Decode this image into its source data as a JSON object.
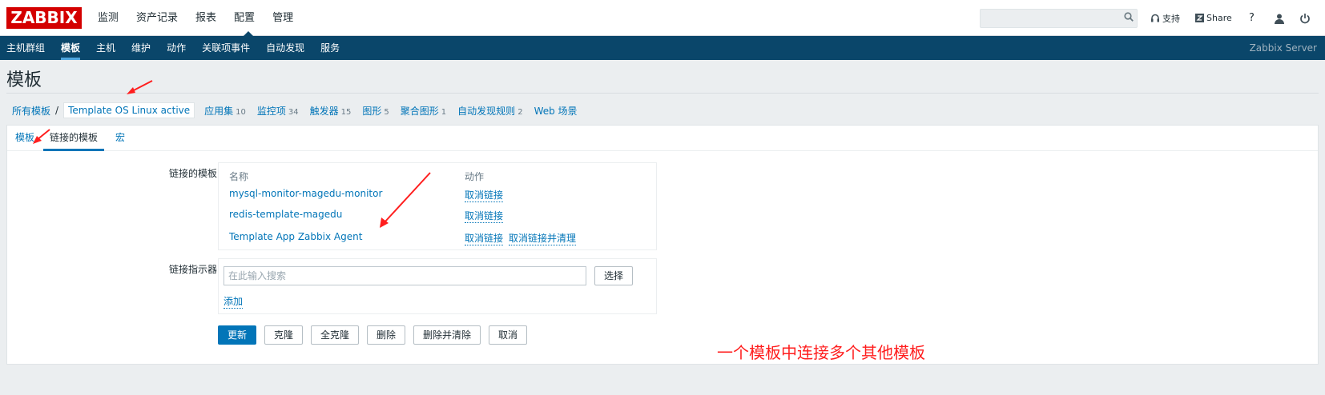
{
  "app": {
    "logo": "ZABBIX",
    "main_nav": [
      "监测",
      "资产记录",
      "报表",
      "配置",
      "管理"
    ],
    "main_nav_active": "配置",
    "search": {
      "placeholder": "",
      "value": ""
    },
    "top_right": {
      "support": "支持",
      "share": "Share",
      "help": "?"
    },
    "sub_nav": [
      "主机群组",
      "模板",
      "主机",
      "维护",
      "动作",
      "关联项事件",
      "自动发现",
      "服务"
    ],
    "sub_nav_active": "模板",
    "server_name": "Zabbix Server"
  },
  "page": {
    "title": "模板",
    "breadcrumb": {
      "all": "所有模板",
      "sep": "/",
      "current": "Template OS Linux active",
      "sections": [
        {
          "label": "应用集",
          "count": "10"
        },
        {
          "label": "监控项",
          "count": "34"
        },
        {
          "label": "触发器",
          "count": "15"
        },
        {
          "label": "图形",
          "count": "5"
        },
        {
          "label": "聚合图形",
          "count": "1"
        },
        {
          "label": "自动发现规则",
          "count": "2"
        },
        {
          "label": "Web 场景",
          "count": ""
        }
      ]
    },
    "tabs": [
      "模板",
      "链接的模板",
      "宏"
    ],
    "active_tab": "链接的模板"
  },
  "form": {
    "linked_label": "链接的模板",
    "linked_table": {
      "col_name": "名称",
      "col_action": "动作",
      "rows": [
        {
          "name": "mysql-monitor-magedu-monitor",
          "unlink": "取消链接",
          "unlink_clear": ""
        },
        {
          "name": "redis-template-magedu",
          "unlink": "取消链接",
          "unlink_clear": ""
        },
        {
          "name": "Template App Zabbix Agent",
          "unlink": "取消链接",
          "unlink_clear": "取消链接并清理"
        }
      ]
    },
    "link_indicator_label": "链接指示器",
    "search_placeholder": "在此输入搜索",
    "select_button": "选择",
    "add_link": "添加",
    "buttons": {
      "update": "更新",
      "clone": "克隆",
      "full_clone": "全克隆",
      "delete": "删除",
      "delete_clear": "删除并清除",
      "cancel": "取消"
    }
  },
  "annotation": "一个模板中连接多个其他模板",
  "colors": {
    "brand": "#d40000",
    "subbar": "#0a466a",
    "link": "#0275b8",
    "annotation": "#ff1e1e"
  }
}
